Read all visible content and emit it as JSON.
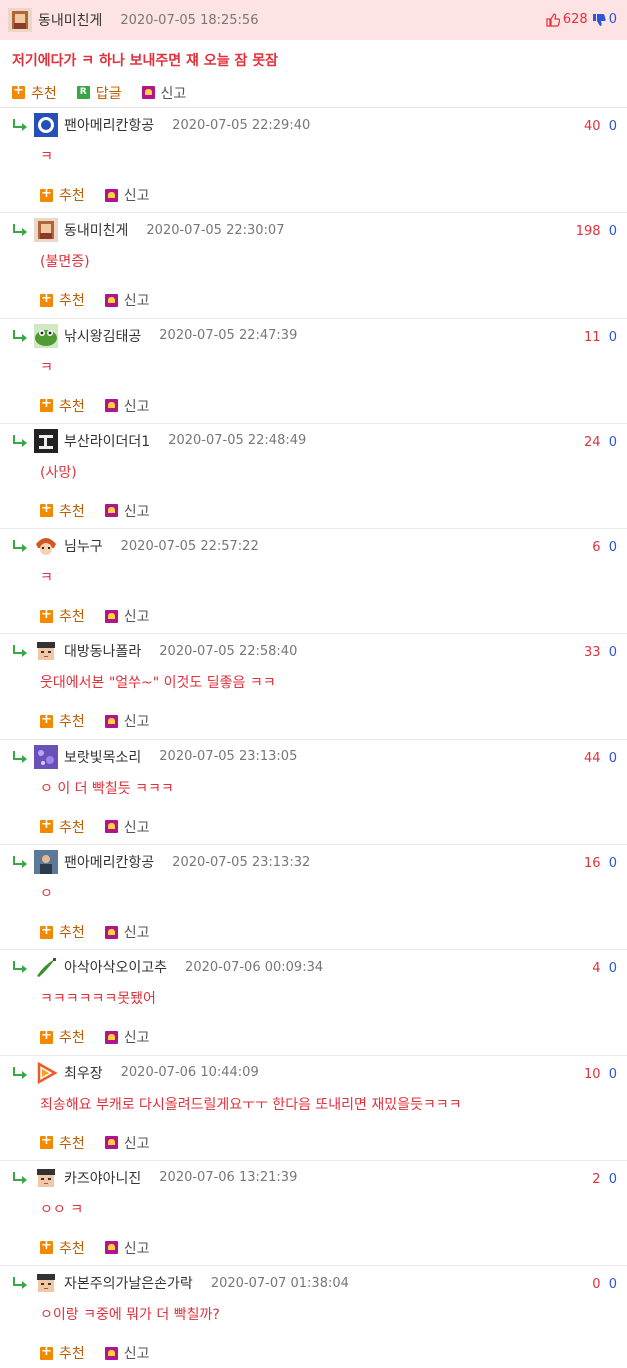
{
  "top_post": {
    "nick": "동내미친게",
    "date": "2020-07-05 18:25:56",
    "up": "628",
    "down": "0",
    "body": "저기에다가 ㅋ 하나 보내주면 쟤 오늘 잠 못잠",
    "actions": {
      "recommend": "추천",
      "reply": "답글",
      "report": "신고"
    }
  },
  "labels": {
    "recommend": "추천",
    "report": "신고"
  },
  "colors": {
    "header_bg": "#fde3e3",
    "up": "#e3303b",
    "down": "#2b56d6",
    "body": "#e3303b",
    "reply_arrow": "#3aa745"
  },
  "comments": [
    {
      "nick": "팬아메리칸항공",
      "date": "2020-07-05 22:29:40",
      "up": "40",
      "down": "0",
      "body": "ㅋ",
      "avatar": "blue-badge-avatar"
    },
    {
      "nick": "동내미친게",
      "date": "2020-07-05 22:30:07",
      "up": "198",
      "down": "0",
      "body": "(불면증)",
      "avatar": "character-avatar"
    },
    {
      "nick": "낚시왕김태공",
      "date": "2020-07-05 22:47:39",
      "up": "11",
      "down": "0",
      "body": "ㅋ",
      "avatar": "frog-avatar"
    },
    {
      "nick": "부산라이더더1",
      "date": "2020-07-05 22:48:49",
      "up": "24",
      "down": "0",
      "body": "(사망)",
      "avatar": "busan-avatar"
    },
    {
      "nick": "님누구",
      "date": "2020-07-05 22:57:22",
      "up": "6",
      "down": "0",
      "body": "ㅋ",
      "avatar": "anime-avatar"
    },
    {
      "nick": "대방동나폴라",
      "date": "2020-07-05 22:58:40",
      "up": "33",
      "down": "0",
      "body": "웃대에서본 \"얼쑤~\" 이것도 딜좋음 ㅋㅋ",
      "avatar": "pixel-face-avatar"
    },
    {
      "nick": "보랏빛목소리",
      "date": "2020-07-05 23:13:05",
      "up": "44",
      "down": "0",
      "body": "ㅇ 이 더 빡칠듯 ㅋㅋㅋ",
      "avatar": "purple-avatar"
    },
    {
      "nick": "팬아메리칸항공",
      "date": "2020-07-05 23:13:32",
      "up": "16",
      "down": "0",
      "body": "ㅇ",
      "avatar": "photo-avatar"
    },
    {
      "nick": "아삭아삭오이고추",
      "date": "2020-07-06 00:09:34",
      "up": "4",
      "down": "0",
      "body": "ㅋㅋㅋㅋㅋㅋ못됐어",
      "avatar": "pepper-avatar"
    },
    {
      "nick": "최우장",
      "date": "2020-07-06 10:44:09",
      "up": "10",
      "down": "0",
      "body": "죄송해요 부캐로 다시올려드릴게요ㅜㅜ 한다음 또내리면 재밌을듯ㅋㅋㅋ",
      "avatar": "play-avatar"
    },
    {
      "nick": "카즈야아니진",
      "date": "2020-07-06 13:21:39",
      "up": "2",
      "down": "0",
      "body": "ㅇㅇ ㅋ",
      "avatar": "pixel-face-avatar"
    },
    {
      "nick": "자본주의가날은손가락",
      "date": "2020-07-07 01:38:04",
      "up": "0",
      "down": "0",
      "body": "ㅇ이랑 ㅋ중에 뭐가 더 빡칠까?",
      "avatar": "pixel-face-avatar"
    }
  ]
}
